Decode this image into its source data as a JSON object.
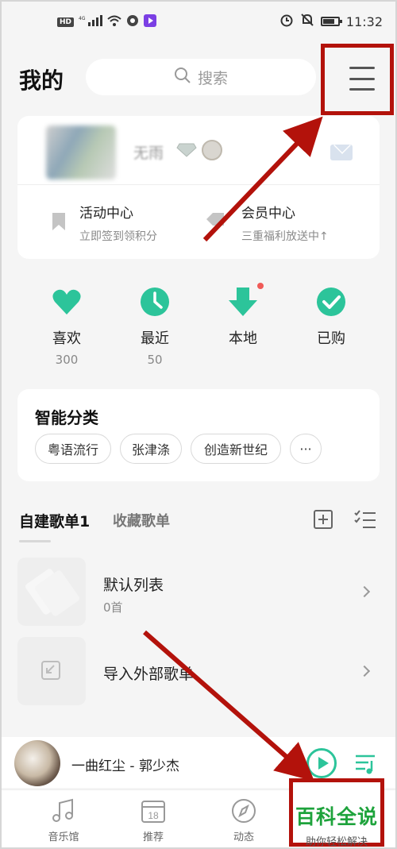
{
  "status_bar": {
    "network": "HD",
    "signal": "4G",
    "time": "11:32"
  },
  "header": {
    "title": "我的",
    "search_placeholder": "搜索"
  },
  "profile": {
    "username": "无雨",
    "activity_title": "活动中心",
    "activity_sub": "立即签到领积分",
    "vip_title": "会员中心",
    "vip_sub": "三重福利放送中↑"
  },
  "quick_actions": [
    {
      "label": "喜欢",
      "count": "300"
    },
    {
      "label": "最近",
      "count": "50"
    },
    {
      "label": "本地",
      "count": ""
    },
    {
      "label": "已购",
      "count": ""
    }
  ],
  "smart_categories": {
    "title": "智能分类",
    "chips": [
      "粤语流行",
      "张津涤",
      "创造新世纪",
      "···"
    ]
  },
  "playlists": {
    "tab_self": "自建歌单1",
    "tab_fav": "收藏歌单",
    "items": [
      {
        "name": "默认列表",
        "count": "0首"
      },
      {
        "name": "导入外部歌单",
        "count": ""
      }
    ]
  },
  "player": {
    "now_playing": "一曲红尘 - 郭少杰"
  },
  "bottom_nav": [
    {
      "label": "音乐馆"
    },
    {
      "label": "推荐"
    },
    {
      "label": "动态"
    }
  ],
  "calendar_day": "18",
  "watermark": {
    "main": "百科全说",
    "sub": "助你轻松解决"
  },
  "colors": {
    "accent": "#2cc49a",
    "annotation_red": "#b3120b",
    "watermark_green": "#1ea33c"
  }
}
